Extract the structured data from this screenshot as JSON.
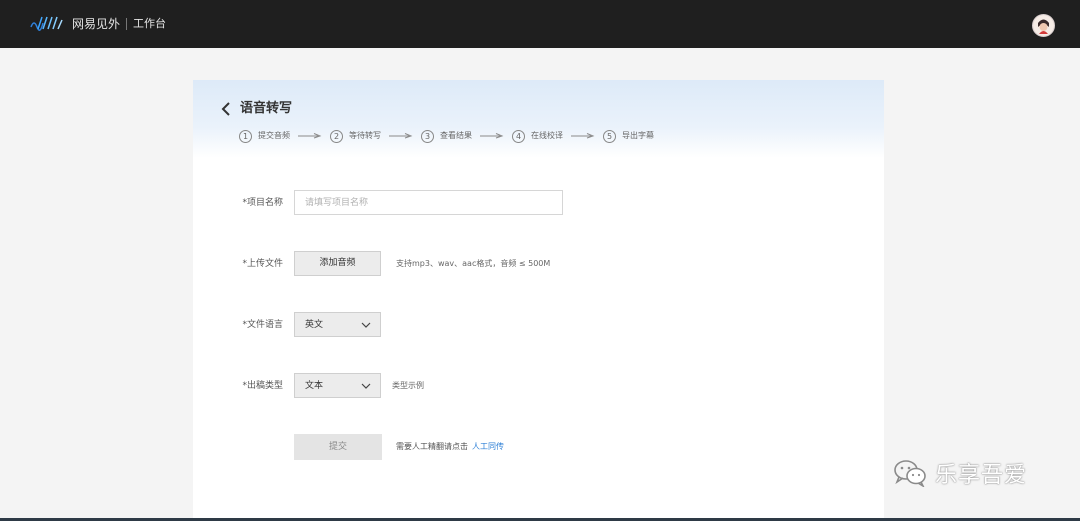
{
  "topbar": {
    "brand_name": "网易见外",
    "brand_sub": "工作台",
    "avatar_icon": "user-avatar-icon"
  },
  "page": {
    "title": "语音转写",
    "back_icon": "chevron-left-icon"
  },
  "steps": [
    {
      "num": "1",
      "label": "提交音频"
    },
    {
      "num": "2",
      "label": "等待转写"
    },
    {
      "num": "3",
      "label": "查看结果"
    },
    {
      "num": "4",
      "label": "在线校译"
    },
    {
      "num": "5",
      "label": "导出字幕"
    }
  ],
  "form": {
    "project_name": {
      "label": "*项目名称",
      "placeholder": "请填写项目名称",
      "value": ""
    },
    "upload": {
      "label": "*上传文件",
      "button": "添加音频",
      "hint": "支持mp3、wav、aac格式，音频 ≤ 500M"
    },
    "language": {
      "label": "*文件语言",
      "value": "英文"
    },
    "output_type": {
      "label": "*出稿类型",
      "value": "文本",
      "hint": "类型示例"
    },
    "submit": {
      "label": "提交",
      "manual_text": "需要人工精翻请点击",
      "manual_link": "人工同传"
    }
  },
  "watermark": {
    "text": "乐享吾爱",
    "icon": "wechat-icon"
  },
  "colors": {
    "topbar": "#1f1f1f",
    "accent_link": "#2d7fd6",
    "header_gradient": "#ddeaf8"
  }
}
